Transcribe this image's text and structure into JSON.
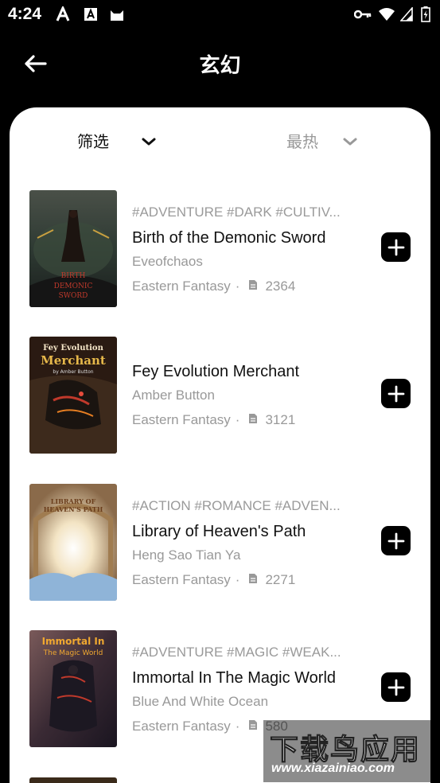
{
  "status_bar": {
    "time": "4:24",
    "left_icons": [
      "font-a-icon",
      "a-box-icon",
      "cat-icon"
    ],
    "right_icons": [
      "key-icon",
      "wifi-icon",
      "signal-icon",
      "battery-icon"
    ]
  },
  "header": {
    "title": "玄幻"
  },
  "filters": {
    "filter_label": "筛选",
    "sort_label": "最热"
  },
  "books": [
    {
      "tags": "#ADVENTURE #DARK #CULTIV...",
      "title": "Birth of the Demonic Sword",
      "author": "Eveofchaos",
      "category": "Eastern Fantasy",
      "separator": "·",
      "chapters": "2364"
    },
    {
      "tags": "",
      "title": "Fey Evolution Merchant",
      "author": "Amber Button",
      "category": "Eastern Fantasy",
      "separator": "·",
      "chapters": "3121"
    },
    {
      "tags": "#ACTION #ROMANCE #ADVEN...",
      "title": "Library of Heaven's Path",
      "author": "Heng Sao Tian Ya",
      "category": "Eastern Fantasy",
      "separator": "·",
      "chapters": "2271"
    },
    {
      "tags": "#ADVENTURE #MAGIC #WEAK...",
      "title": "Immortal In The Magic World",
      "author": "Blue And White Ocean",
      "category": "Eastern Fantasy",
      "separator": "·",
      "chapters": "580"
    }
  ],
  "watermark": {
    "text": "下载鸟应用",
    "url": "www.xiazainiao.com"
  }
}
